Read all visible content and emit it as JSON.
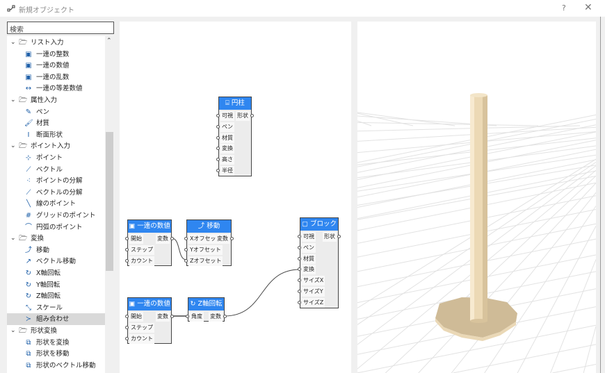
{
  "window": {
    "title": "新規オブジェクト",
    "help": "?",
    "close": "✕"
  },
  "search": {
    "placeholder": "検索"
  },
  "tree": [
    {
      "type": "group",
      "label": "リスト入力"
    },
    {
      "type": "item",
      "label": "一連の整数",
      "icon": "integer-series-icon",
      "glyph": "▣"
    },
    {
      "type": "item",
      "label": "一連の数値",
      "icon": "number-series-icon",
      "glyph": "▣"
    },
    {
      "type": "item",
      "label": "一連の乱数",
      "icon": "random-series-icon",
      "glyph": "▣"
    },
    {
      "type": "item",
      "label": "一連の等差数値",
      "icon": "arithmetic-series-icon",
      "glyph": "↔"
    },
    {
      "type": "group",
      "label": "属性入力"
    },
    {
      "type": "item",
      "label": "ペン",
      "icon": "pen-icon",
      "glyph": "✎"
    },
    {
      "type": "item",
      "label": "材質",
      "icon": "material-brush-icon",
      "glyph": "🖌"
    },
    {
      "type": "item",
      "label": "断面形状",
      "icon": "profile-icon",
      "glyph": "I"
    },
    {
      "type": "group",
      "label": "ポイント入力"
    },
    {
      "type": "item",
      "label": "ポイント",
      "icon": "point-icon",
      "glyph": "⊹"
    },
    {
      "type": "item",
      "label": "ベクトル",
      "icon": "vector-icon",
      "glyph": "⟋"
    },
    {
      "type": "item",
      "label": "ポイントの分解",
      "icon": "point-decompose-icon",
      "glyph": "⁖"
    },
    {
      "type": "item",
      "label": "ベクトルの分解",
      "icon": "vector-decompose-icon",
      "glyph": "⟋"
    },
    {
      "type": "item",
      "label": "線のポイント",
      "icon": "line-point-icon",
      "glyph": "╲"
    },
    {
      "type": "item",
      "label": "グリッドのポイント",
      "icon": "grid-point-icon",
      "glyph": "#"
    },
    {
      "type": "item",
      "label": "円弧のポイント",
      "icon": "arc-point-icon",
      "glyph": "⌒"
    },
    {
      "type": "group",
      "label": "変換"
    },
    {
      "type": "item",
      "label": "移動",
      "icon": "move-icon",
      "glyph": "⤴"
    },
    {
      "type": "item",
      "label": "ベクトル移動",
      "icon": "vector-move-icon",
      "glyph": "↗"
    },
    {
      "type": "item",
      "label": "X軸回転",
      "icon": "rotate-x-icon",
      "glyph": "↻"
    },
    {
      "type": "item",
      "label": "Y軸回転",
      "icon": "rotate-y-icon",
      "glyph": "↻"
    },
    {
      "type": "item",
      "label": "Z軸回転",
      "icon": "rotate-z-icon",
      "glyph": "↻"
    },
    {
      "type": "item",
      "label": "スケール",
      "icon": "scale-icon",
      "glyph": "⤡"
    },
    {
      "type": "item",
      "label": "組み合わせ",
      "icon": "combine-icon",
      "glyph": "≻",
      "selected": true
    },
    {
      "type": "group",
      "label": "形状変換"
    },
    {
      "type": "item",
      "label": "形状を変換",
      "icon": "shape-transform-icon",
      "glyph": "⧉"
    },
    {
      "type": "item",
      "label": "形状を移動",
      "icon": "shape-move-icon",
      "glyph": "⧉"
    },
    {
      "type": "item",
      "label": "形状のベクトル移動",
      "icon": "shape-vector-move-icon",
      "glyph": "⧉"
    }
  ],
  "nodes": [
    {
      "id": "cylinder",
      "title": "円柱",
      "icon": "⌸",
      "inputs": [
        "可視",
        "ペン",
        "材質",
        "変換",
        "高さ",
        "半径"
      ],
      "outputs": [
        "形状"
      ]
    },
    {
      "id": "series1",
      "title": "一連の数値",
      "icon": "▣",
      "inputs": [
        "開始",
        "ステップ",
        "カウント"
      ],
      "outputs": [
        "変数"
      ]
    },
    {
      "id": "move",
      "title": "移動",
      "icon": "⤴",
      "inputs": [
        "Xオフセット",
        "Yオフセット",
        "Zオフセット"
      ],
      "outputs": [
        "変数"
      ]
    },
    {
      "id": "block",
      "title": "ブロック",
      "icon": "▢",
      "inputs": [
        "可視",
        "ペン",
        "材質",
        "変換",
        "サイズX",
        "サイズY",
        "サイズZ"
      ],
      "outputs": [
        "形状"
      ]
    },
    {
      "id": "series2",
      "title": "一連の数値",
      "icon": "▣",
      "inputs": [
        "開始",
        "ステップ",
        "カウント"
      ],
      "outputs": [
        "変数"
      ]
    },
    {
      "id": "rotz",
      "title": "Z軸回転",
      "icon": "↻",
      "inputs": [
        "角度"
      ],
      "outputs": [
        "変数"
      ]
    }
  ],
  "colors": {
    "node_header": "#2f86f0",
    "object": "#e9d7b5",
    "object_shadow": "#cdb996"
  }
}
